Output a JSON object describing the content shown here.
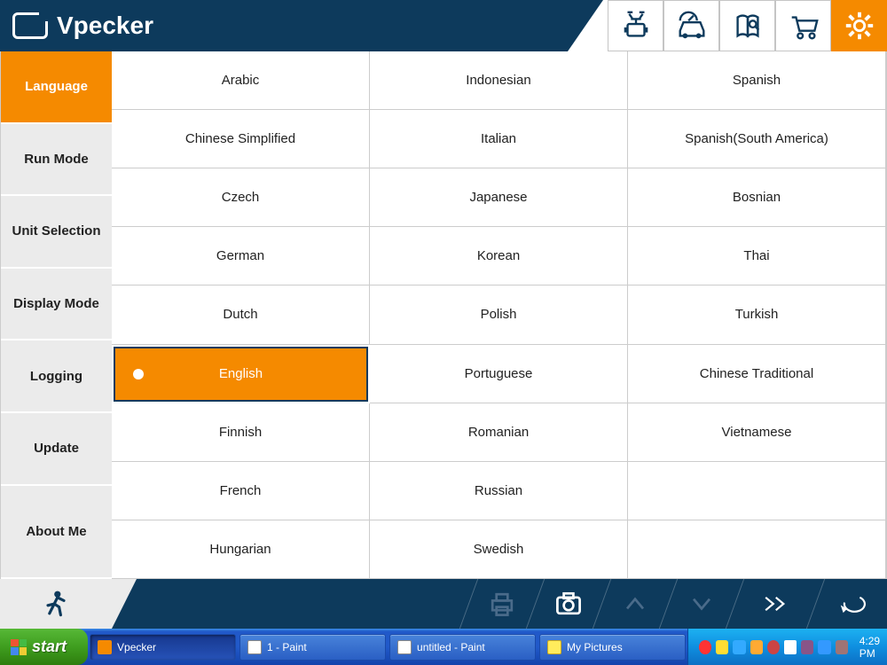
{
  "brand": "Vpecker",
  "header_buttons": [
    "diagnose",
    "car",
    "manual",
    "cart",
    "settings"
  ],
  "header_active": "settings",
  "sidebar": {
    "items": [
      {
        "label": "Language"
      },
      {
        "label": "Run Mode"
      },
      {
        "label": "Unit Selection"
      },
      {
        "label": "Display Mode"
      },
      {
        "label": "Logging"
      },
      {
        "label": "Update"
      },
      {
        "label": "About Me"
      }
    ],
    "active": "Language"
  },
  "languages": {
    "columns": [
      [
        "Arabic",
        "Chinese Simplified",
        "Czech",
        "German",
        "Dutch",
        "English",
        "Finnish",
        "French",
        "Hungarian"
      ],
      [
        "Indonesian",
        "Italian",
        "Japanese",
        "Korean",
        "Polish",
        "Portuguese",
        "Romanian",
        "Russian",
        "Swedish"
      ],
      [
        "Spanish",
        "Spanish(South America)",
        "Bosnian",
        "Thai",
        "Turkish",
        "Chinese Traditional",
        "Vietnamese",
        "",
        ""
      ]
    ],
    "selected": "English"
  },
  "footer": {
    "buttons": [
      "exit",
      "print",
      "camera",
      "up",
      "down",
      "forward",
      "back"
    ]
  },
  "taskbar": {
    "start": "start",
    "items": [
      {
        "label": "Vpecker",
        "icon": "vpecker",
        "active": true
      },
      {
        "label": "1 - Paint",
        "icon": "paint",
        "active": false
      },
      {
        "label": "untitled - Paint",
        "icon": "paint",
        "active": false
      },
      {
        "label": "My Pictures",
        "icon": "pics",
        "active": false
      }
    ],
    "clock": "4:29 PM"
  }
}
